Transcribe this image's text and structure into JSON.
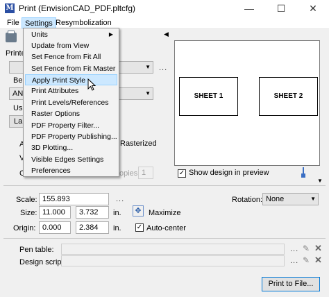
{
  "window": {
    "app_icon_glyph": "M",
    "title": "Print (EnvisionCAD_PDF.pltcfg)",
    "minimize": "—",
    "maximize": "☐",
    "close": "✕"
  },
  "menubar": {
    "file": "File",
    "settings": "Settings",
    "resymbolization": "Resymbolization"
  },
  "settings_menu": {
    "items": [
      "Units",
      "Update from View",
      "Set Fence from Fit All",
      "Set Fence from Fit Master",
      "Apply Print Style",
      "Print Attributes",
      "Print Levels/References",
      "Raster Options",
      "PDF Property Filter...",
      "PDF Property Publishing...",
      "3D Plotting...",
      "Visible Edges Settings",
      "Preferences"
    ],
    "highlighted": "Apply Print Style"
  },
  "left_panel": {
    "printer_label": "Printe",
    "be_label": "Be",
    "an_value": "AN",
    "us_label": "Us",
    "la_value": "La",
    "a_label": "A",
    "v_label": "V",
    "c_label": "C",
    "rasterized_label": "Rasterized",
    "copies_label": "opies:",
    "copies_value": "1",
    "ellipsis": "..."
  },
  "preview": {
    "sheet1": "SHEET 1",
    "sheet2": "SHEET 2",
    "show_design_label": "Show design in preview",
    "show_design_checked": true
  },
  "scale": {
    "label": "Scale:",
    "value": "155.893",
    "ellipsis": "..."
  },
  "rotation": {
    "label": "Rotation:",
    "value": "None"
  },
  "size": {
    "label": "Size:",
    "x": "11.000",
    "y": "3.732",
    "unit": "in.",
    "maximize_label": "Maximize"
  },
  "origin": {
    "label": "Origin:",
    "x": "0.000",
    "y": "2.384",
    "unit": "in.",
    "autocenter_label": "Auto-center",
    "autocenter_checked": true
  },
  "pen_table": {
    "label": "Pen table:",
    "value": ""
  },
  "design_script": {
    "label": "Design script:",
    "value": ""
  },
  "print_button": "Print to File...",
  "colors": {
    "highlight": "#cce8ff",
    "highlight_border": "#99d1ff",
    "app_icon": "#2b4fa3",
    "pen_icon": "#3a6fc4"
  }
}
